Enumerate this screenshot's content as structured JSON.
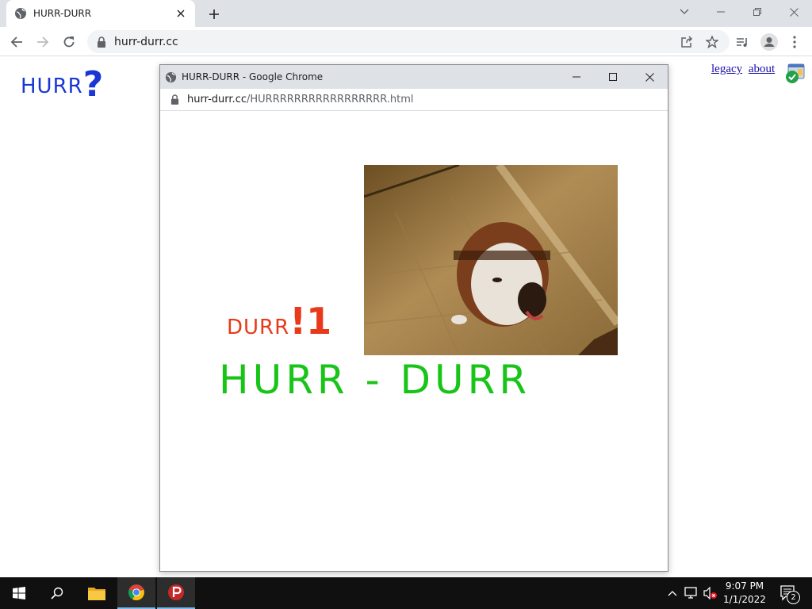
{
  "browser": {
    "tab_title": "HURR-DURR",
    "url": "hurr-durr.cc"
  },
  "page": {
    "logo_text": "HURR",
    "logo_mark": "?",
    "links": [
      "legacy",
      "about"
    ]
  },
  "popup": {
    "title": "HURR-DURR - Google Chrome",
    "url_host": "hurr-durr.cc",
    "url_path": "/HURRRRRRRRRRRRRRRRR.html",
    "durr_small": "DURR",
    "durr_big": "!1",
    "headline": "HURR - DURR"
  },
  "taskbar": {
    "time": "9:07 PM",
    "date": "1/1/2022",
    "notifications": "2"
  },
  "icons": [
    "globe-icon",
    "close-icon",
    "plus-icon",
    "back-icon",
    "forward-icon",
    "reload-icon",
    "lock-icon",
    "share-icon",
    "star-icon",
    "reading-list-icon",
    "profile-icon",
    "menu-icon",
    "windows-icon",
    "search-icon",
    "folder-icon",
    "chrome-icon",
    "psiphon-icon"
  ],
  "colors": {
    "logo_blue": "#1a37d6",
    "durr_red": "#e83a1a",
    "headline_green": "#18c418"
  }
}
